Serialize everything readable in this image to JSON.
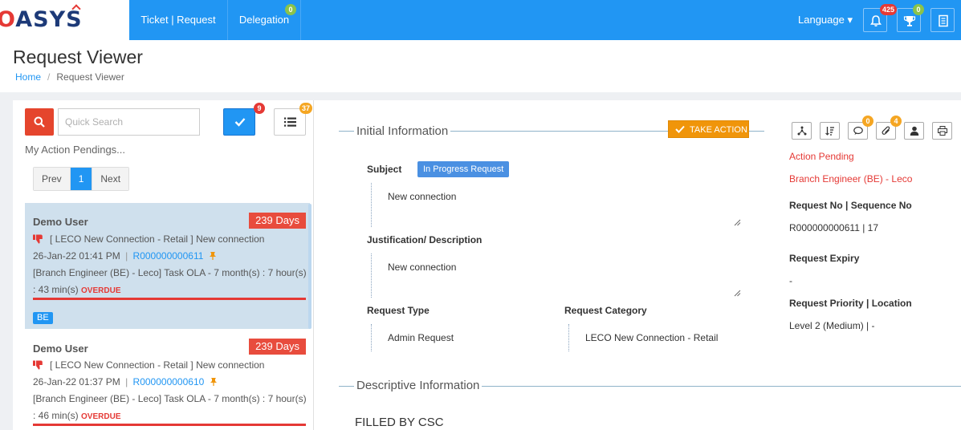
{
  "brand": {
    "logo_text": "OASYS"
  },
  "nav": {
    "ticket_label": "Ticket | Request",
    "delegation_label": "Delegation",
    "delegation_badge": "0",
    "language_label": "Language ▾",
    "notifications_badge": "425",
    "trophy_badge": "0"
  },
  "page": {
    "title": "Request Viewer",
    "breadcrumb_home": "Home",
    "breadcrumb_current": "Request Viewer"
  },
  "left": {
    "search_placeholder": "Quick Search",
    "check_badge": "9",
    "list_badge": "37",
    "pending_label": "My Action Pendings...",
    "pager": {
      "prev": "Prev",
      "page": "1",
      "next": "Next"
    },
    "cards": [
      {
        "user": "Demo User",
        "days": "239 Days",
        "title": "[ LECO New Connection - Retail ] New connection",
        "datetime": "26-Jan-22 01:41 PM",
        "request_no": "R000000000611",
        "task_line": "[Branch Engineer (BE) - Leco] Task OLA - 7 month(s) : 7 hour(s)",
        "min_line": ": 43 min(s)",
        "overdue": "OVERDUE",
        "tag": "BE"
      },
      {
        "user": "Demo User",
        "days": "239 Days",
        "title": "[ LECO New Connection - Retail ] New connection",
        "datetime": "26-Jan-22 01:37 PM",
        "request_no": "R000000000610",
        "task_line": "[Branch Engineer (BE) - Leco] Task OLA - 7 month(s) : 7 hour(s)",
        "min_line": ": 46 min(s)",
        "overdue": "OVERDUE"
      }
    ]
  },
  "detail": {
    "initial_title": "Initial Information",
    "take_action": "TAKE ACTION",
    "tool_badges": {
      "comments": "0",
      "attachments": "4"
    },
    "subject_label": "Subject",
    "status_pill": "In Progress Request",
    "subject_value": "New connection",
    "justification_label": "Justification/ Description",
    "justification_value": "New connection",
    "type_label": "Request Type",
    "type_value": "Admin Request",
    "category_label": "Request Category",
    "category_value": "LECO New Connection - Retail",
    "descriptive_title": "Descriptive Information",
    "filled_by": "FILLED BY CSC"
  },
  "side": {
    "action_pending": "Action Pending",
    "assignee": "Branch Engineer (BE) - Leco",
    "reqno_label": "Request No | Sequence No",
    "reqno_value": "R000000000611 | 17",
    "expiry_label": "Request Expiry",
    "expiry_value": "-",
    "priority_label": "Request Priority | Location",
    "priority_value": "Level 2 (Medium) | -"
  },
  "colors": {
    "primary": "#2196f3",
    "danger": "#e84c3d",
    "warning": "#f0950a",
    "success": "#8bc34a"
  }
}
